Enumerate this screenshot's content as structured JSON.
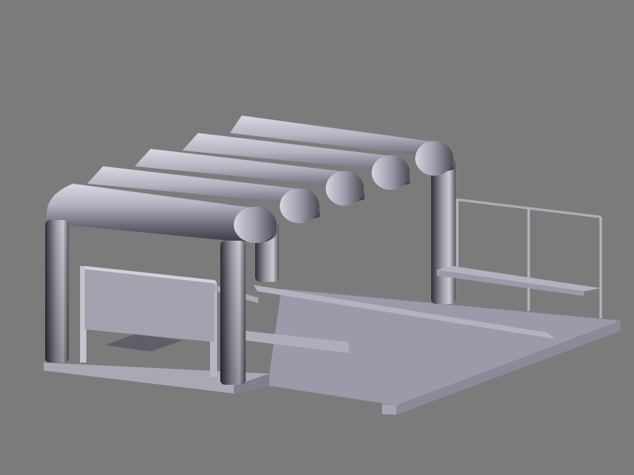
{
  "scene": {
    "background_color": "#7b7b7b",
    "colors": {
      "floor_top": "#9a9aaa",
      "floor_front": "#8c8c9c",
      "floor_side": "#6e6e7e",
      "panel": "#a2a2ae",
      "panel_edge": "#cfcfd6",
      "tube_dark": "#3a3a44",
      "tube_mid": "#8e8e9c",
      "tube_light": "#e0e0ea",
      "rail": "#9a9aa8",
      "shadow": "#5c5c66"
    },
    "objects": {
      "roof_tubes": 5,
      "support_posts": 4,
      "benches": 1,
      "railings": 1,
      "sign_panels": 1
    }
  }
}
